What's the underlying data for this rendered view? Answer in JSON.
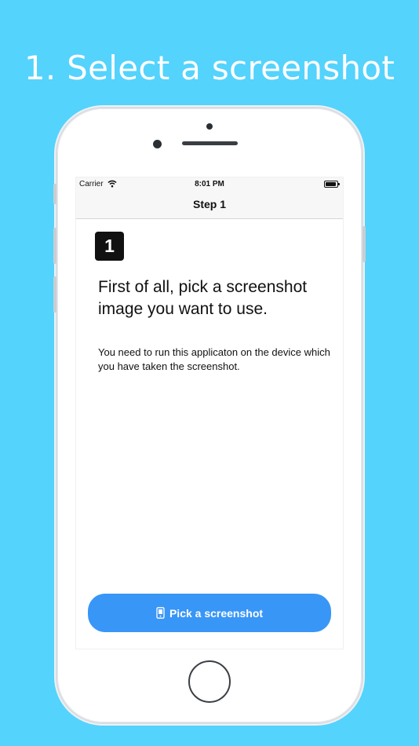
{
  "promo": {
    "title": "1. Select a screenshot"
  },
  "status_bar": {
    "carrier": "Carrier",
    "time": "8:01 PM"
  },
  "nav": {
    "title": "Step 1"
  },
  "content": {
    "step_number": "1",
    "headline": "First of all, pick a screenshot image you want to use.",
    "description": "You need to run this applicaton on the device which you have taken the screenshot."
  },
  "actions": {
    "pick_label": "Pick a screenshot"
  },
  "icons": {
    "wifi": "wifi-icon",
    "battery": "battery-icon",
    "phone": "phone-icon"
  },
  "colors": {
    "background": "#54d3fd",
    "button": "#3896f7"
  }
}
